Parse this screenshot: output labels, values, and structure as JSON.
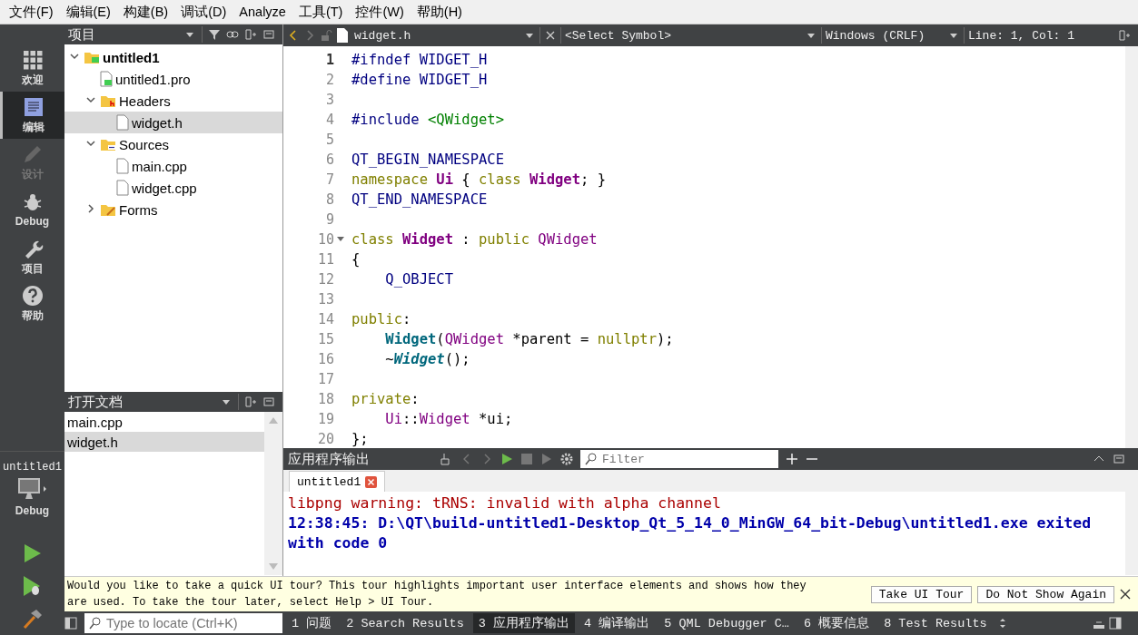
{
  "menu": [
    "文件(F)",
    "编辑(E)",
    "构建(B)",
    "调试(D)",
    "Analyze",
    "工具(T)",
    "控件(W)",
    "帮助(H)"
  ],
  "modes": [
    {
      "label": "欢迎",
      "kind": "grid",
      "selected": false,
      "disabled": false
    },
    {
      "label": "编辑",
      "kind": "edit",
      "selected": true,
      "disabled": false
    },
    {
      "label": "设计",
      "kind": "pen",
      "selected": false,
      "disabled": true
    },
    {
      "label": "Debug",
      "kind": "bug",
      "selected": false,
      "disabled": false
    },
    {
      "label": "项目",
      "kind": "wrench",
      "selected": false,
      "disabled": false
    },
    {
      "label": "帮助",
      "kind": "help",
      "selected": false,
      "disabled": false
    }
  ],
  "target": {
    "project": "untitled1",
    "config": "Debug"
  },
  "projects_panel": {
    "title": "项目",
    "tree": [
      {
        "label": "untitled1",
        "kind": "project",
        "expanded": true,
        "selected": false,
        "children": [
          {
            "label": "untitled1.pro",
            "kind": "pro",
            "selected": false
          },
          {
            "label": "Headers",
            "kind": "headers",
            "expanded": true,
            "selected": false,
            "children": [
              {
                "label": "widget.h",
                "kind": "file",
                "selected": true
              }
            ]
          },
          {
            "label": "Sources",
            "kind": "sources",
            "expanded": true,
            "selected": false,
            "children": [
              {
                "label": "main.cpp",
                "kind": "file",
                "selected": false
              },
              {
                "label": "widget.cpp",
                "kind": "file",
                "selected": false
              }
            ]
          },
          {
            "label": "Forms",
            "kind": "forms",
            "expanded": false,
            "selected": false
          }
        ]
      }
    ]
  },
  "open_documents": {
    "title": "打开文档",
    "items": [
      {
        "label": "main.cpp",
        "selected": false
      },
      {
        "label": "widget.h",
        "selected": true
      }
    ]
  },
  "editor_toolbar": {
    "file": "widget.h",
    "symbol": "<Select Symbol>",
    "line_ending": "Windows (CRLF)",
    "position": "Line: 1, Col: 1"
  },
  "code": [
    {
      "number": "1",
      "current": true,
      "foldable": false,
      "tokens": [
        {
          "t": "#ifndef WIDGET_H",
          "kind": "pre"
        }
      ]
    },
    {
      "number": "2",
      "current": false,
      "foldable": false,
      "tokens": [
        {
          "t": "#define WIDGET_H",
          "kind": "pre"
        }
      ]
    },
    {
      "number": "3",
      "current": false,
      "foldable": false
    },
    {
      "number": "4",
      "current": false,
      "foldable": false,
      "tokens": [
        {
          "t": "#include ",
          "kind": "pre"
        },
        {
          "t": "<QWidget>",
          "kind": "str"
        }
      ]
    },
    {
      "number": "5",
      "current": false,
      "foldable": false
    },
    {
      "number": "6",
      "current": false,
      "foldable": false,
      "tokens": [
        {
          "t": "QT_BEGIN_NAMESPACE",
          "kind": "macro"
        }
      ]
    },
    {
      "number": "7",
      "current": false,
      "foldable": false,
      "tokens": [
        {
          "t": "namespace ",
          "kind": "kw"
        },
        {
          "t": "Ui",
          "kind": "typeb"
        },
        {
          "t": " { ",
          "kind": "plain"
        },
        {
          "t": "class ",
          "kind": "kw"
        },
        {
          "t": "Widget",
          "kind": "typeb"
        },
        {
          "t": "; }",
          "kind": "plain"
        }
      ]
    },
    {
      "number": "8",
      "current": false,
      "foldable": false,
      "tokens": [
        {
          "t": "QT_END_NAMESPACE",
          "kind": "macro"
        }
      ]
    },
    {
      "number": "9",
      "current": false,
      "foldable": false
    },
    {
      "number": "10",
      "current": false,
      "foldable": true,
      "tokens": [
        {
          "t": "class ",
          "kind": "kw"
        },
        {
          "t": "Widget",
          "kind": "typeb"
        },
        {
          "t": " : ",
          "kind": "plain"
        },
        {
          "t": "public ",
          "kind": "kw"
        },
        {
          "t": "QWidget",
          "kind": "type"
        }
      ]
    },
    {
      "number": "11",
      "current": false,
      "foldable": false,
      "tokens": [
        {
          "t": "{",
          "kind": "plain"
        }
      ]
    },
    {
      "number": "12",
      "current": false,
      "foldable": false,
      "tokens": [
        {
          "t": "    Q_OBJECT",
          "kind": "macro"
        }
      ]
    },
    {
      "number": "13",
      "current": false,
      "foldable": false
    },
    {
      "number": "14",
      "current": false,
      "foldable": false,
      "tokens": [
        {
          "t": "public",
          "kind": "kw"
        },
        {
          "t": ":",
          "kind": "plain"
        }
      ]
    },
    {
      "number": "15",
      "current": false,
      "foldable": false,
      "tokens": [
        {
          "t": "    Widget",
          "kind": "func"
        },
        {
          "t": "(",
          "kind": "plain"
        },
        {
          "t": "QWidget",
          "kind": "type"
        },
        {
          "t": " *parent = ",
          "kind": "plain"
        },
        {
          "t": "nullptr",
          "kind": "kw"
        },
        {
          "t": ");",
          "kind": "plain"
        }
      ]
    },
    {
      "number": "16",
      "current": false,
      "foldable": false,
      "tokens": [
        {
          "t": "    ~",
          "kind": "plain"
        },
        {
          "t": "Widget",
          "kind": "funci"
        },
        {
          "t": "();",
          "kind": "plain"
        }
      ]
    },
    {
      "number": "17",
      "current": false,
      "foldable": false
    },
    {
      "number": "18",
      "current": false,
      "foldable": false,
      "tokens": [
        {
          "t": "private",
          "kind": "kw"
        },
        {
          "t": ":",
          "kind": "plain"
        }
      ]
    },
    {
      "number": "19",
      "current": false,
      "foldable": false,
      "tokens": [
        {
          "t": "    Ui",
          "kind": "type"
        },
        {
          "t": "::",
          "kind": "plain"
        },
        {
          "t": "Widget",
          "kind": "type"
        },
        {
          "t": " *ui;",
          "kind": "plain"
        }
      ]
    },
    {
      "number": "20",
      "current": false,
      "foldable": false,
      "tokens": [
        {
          "t": "};",
          "kind": "plain"
        }
      ]
    }
  ],
  "output_pane": {
    "title": "应用程序输出",
    "filter_placeholder": "Filter",
    "tab": "untitled1",
    "lines": [
      {
        "kind": "error",
        "text": "libpng warning: tRNS: invalid with alpha channel"
      },
      {
        "kind": "info",
        "text": "12:38:45: D:\\QT\\build-untitled1-Desktop_Qt_5_14_0_MinGW_64_bit-Debug\\untitled1.exe exited with code 0"
      }
    ]
  },
  "tour_bar": {
    "text": "Would you like to take a quick UI tour? This tour highlights important user interface elements and shows how they are used. To take the tour later, select Help > UI Tour.",
    "buttons": [
      "Take UI Tour",
      "Do Not Show Again"
    ]
  },
  "status_bar": {
    "locator_placeholder": "Type to locate (Ctrl+K)",
    "tabs": [
      {
        "label": "1 问题",
        "selected": false
      },
      {
        "label": "2 Search Results",
        "selected": false
      },
      {
        "label": "3 应用程序输出",
        "selected": true
      },
      {
        "label": "4 编译输出",
        "selected": false
      },
      {
        "label": "5 QML Debugger C…",
        "selected": false
      },
      {
        "label": "6 概要信息",
        "selected": false
      },
      {
        "label": "8 Test Results",
        "selected": false
      }
    ]
  }
}
